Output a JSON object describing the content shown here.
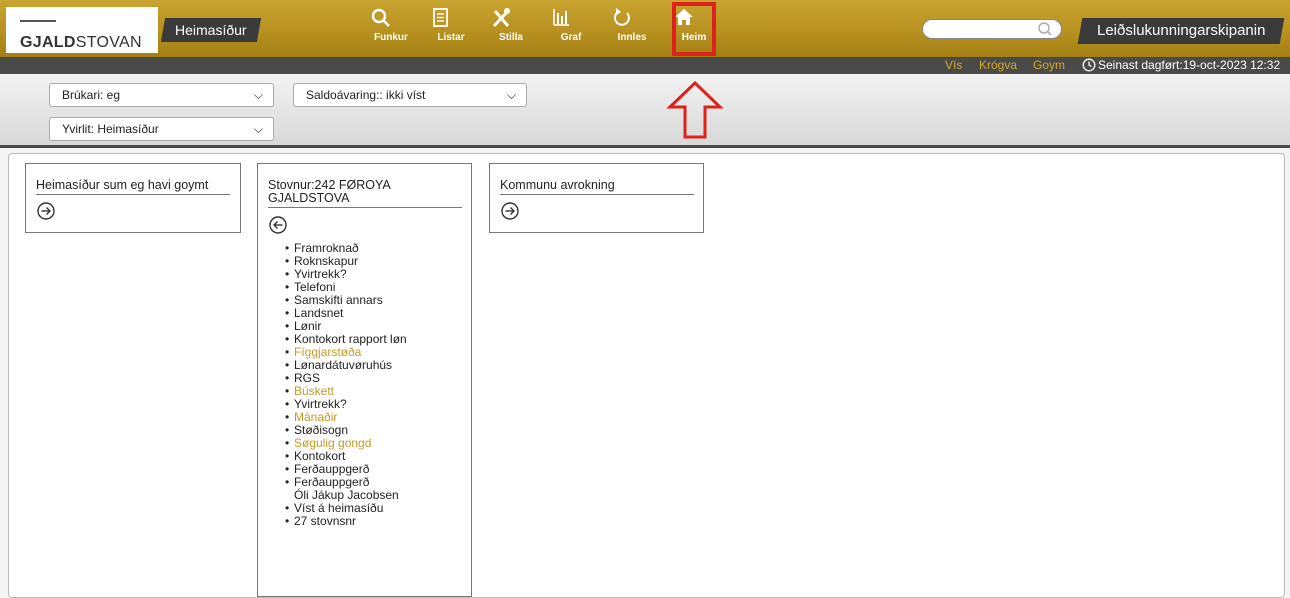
{
  "header": {
    "logo_bold": "GJALD",
    "logo_rest": "STOVAN",
    "section_tab": "Heimasíður",
    "nav": [
      {
        "label": "Funkur",
        "icon": "search-icon"
      },
      {
        "label": "Listar",
        "icon": "document-icon"
      },
      {
        "label": "Stilla",
        "icon": "tools-icon"
      },
      {
        "label": "Graf",
        "icon": "bar-chart-icon"
      },
      {
        "label": "Innles",
        "icon": "refresh-icon"
      },
      {
        "label": "Heim",
        "icon": "home-icon"
      }
    ],
    "search_placeholder": "",
    "right_tab": "Leiðslukunningarskipanin"
  },
  "strip": {
    "vis": "Vís",
    "krogva": "Krógva",
    "goym": "Goym",
    "last_updated": "Seinast dagført:19-oct-2023 12:32"
  },
  "filters": {
    "user": "Brúkari: eg",
    "balance_warning": "Saldoávaring:: ikki víst",
    "overview": "Yvirlit: Heimasíður"
  },
  "panels": {
    "saved": {
      "title": "Heimasíður sum eg havi goymt"
    },
    "institution": {
      "title_line1": "Stovnur:242 FØROYA",
      "title_line2": "GJALDSTOVA",
      "links": [
        {
          "text": "Framroknað",
          "gold": false,
          "bullet": true
        },
        {
          "text": "Roknskapur",
          "gold": false,
          "bullet": true
        },
        {
          "text": "Yvirtrekk?",
          "gold": false,
          "bullet": true
        },
        {
          "text": "Telefoni",
          "gold": false,
          "bullet": true
        },
        {
          "text": "Samskifti annars",
          "gold": false,
          "bullet": true
        },
        {
          "text": "Landsnet",
          "gold": false,
          "bullet": true
        },
        {
          "text": "Lønir",
          "gold": false,
          "bullet": true
        },
        {
          "text": "Kontokort rapport løn",
          "gold": false,
          "bullet": true
        },
        {
          "text": "Fíggjarstøða",
          "gold": true,
          "bullet": true
        },
        {
          "text": "Lønardátuvøruhús",
          "gold": false,
          "bullet": true
        },
        {
          "text": "RGS",
          "gold": false,
          "bullet": true
        },
        {
          "text": "Búskett",
          "gold": true,
          "bullet": true
        },
        {
          "text": "Yvirtrekk?",
          "gold": false,
          "bullet": true
        },
        {
          "text": "Mánaðir",
          "gold": true,
          "bullet": true
        },
        {
          "text": "Støðisogn",
          "gold": false,
          "bullet": true
        },
        {
          "text": "Søgulig gongd",
          "gold": true,
          "bullet": true
        },
        {
          "text": "Kontokort",
          "gold": false,
          "bullet": true
        },
        {
          "text": "Ferðauppgerð",
          "gold": false,
          "bullet": true
        },
        {
          "text": "Ferðauppgerð",
          "gold": false,
          "bullet": true
        },
        {
          "text": "Óli Jákup Jacobsen",
          "gold": false,
          "bullet": false
        },
        {
          "text": "Víst á heimasíðu",
          "gold": false,
          "bullet": true
        },
        {
          "text": "27 stovnsnr",
          "gold": false,
          "bullet": true
        }
      ]
    },
    "municipal": {
      "title": "Kommunu avrokning"
    }
  },
  "colors": {
    "gold": "#c49a2a",
    "highlight_red": "#e0201a",
    "bar": "#b89120"
  }
}
